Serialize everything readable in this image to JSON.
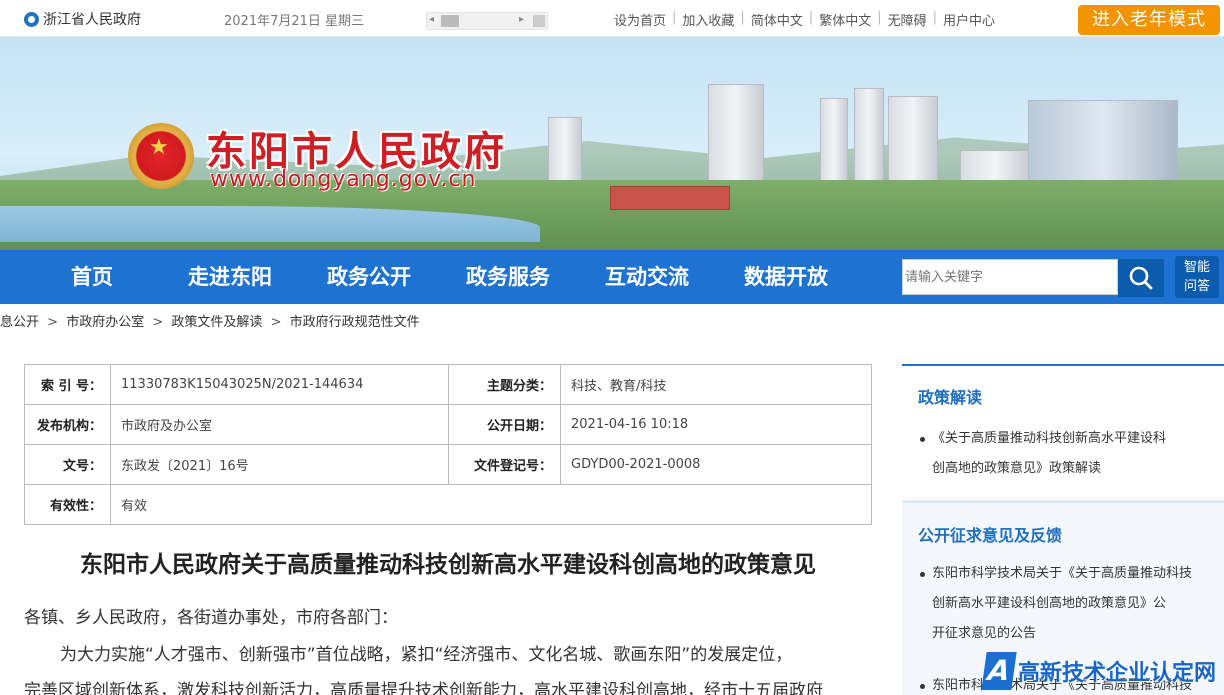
{
  "topbar": {
    "province": "浙江省人民政府",
    "date": "2021年7月21日 星期三",
    "links": [
      "设为首页",
      "加入收藏",
      "简体中文",
      "繁体中文",
      "无障碍",
      "用户中心"
    ],
    "elder_mode": "进入老年模式"
  },
  "banner": {
    "title": "东阳市人民政府",
    "url": "www.dongyang.gov.cn"
  },
  "nav": {
    "items": [
      "首页",
      "走进东阳",
      "政务公开",
      "政务服务",
      "互动交流",
      "数据开放"
    ],
    "search_placeholder": "请输入关键字",
    "smart_line1": "智能",
    "smart_line2": "问答"
  },
  "breadcrumb": [
    "息公开",
    "市政府办公室",
    "政策文件及解读",
    "市政府行政规范性文件"
  ],
  "info": {
    "index_label": "索 引 号：",
    "index_value": "11330783K15043025N/2021-144634",
    "topic_label": "主题分类：",
    "topic_value": "科技、教育/科技",
    "org_label": "发布机构：",
    "org_value": "市政府及办公室",
    "pubdate_label": "公开日期：",
    "pubdate_value": "2021-04-16 10:18",
    "docno_label": "文号：",
    "docno_value": "东政发〔2021〕16号",
    "regno_label": "文件登记号：",
    "regno_value": "GDYD00-2021-0008",
    "valid_label": "有效性：",
    "valid_value": "有效"
  },
  "document": {
    "title": "东阳市人民政府关于高质量推动科技创新高水平建设科创高地的政策意见",
    "salutation": "各镇、乡人民政府，各街道办事处，市府各部门：",
    "para1": "为大力实施“人才强市、创新强市”首位战略，紧扣“经济强市、文化名城、歌画东阳”的发展定位，",
    "para2": "完善区域创新体系，激发科技创新活力，高质量提升技术创新能力，高水平建设科创高地，经市十五届政府"
  },
  "sidebar": {
    "policy_head": "政策解读",
    "policy_item_l1": "《关于高质量推动科技创新高水平建设科",
    "policy_item_l2": "创高地的政策意见》政策解读",
    "consult_head": "公开征求意见及反馈",
    "consult_item_l1": "东阳市科学技术局关于《关于高质量推动科技",
    "consult_item_l2": "创新高水平建设科创高地的政策意见》公",
    "consult_item_l3": "开征求意见的公告",
    "consult_item2": "东阳市科学技术局关于《关于高质量推动科技"
  },
  "watermark": {
    "logo_letter": "A",
    "text": "高新技术企业认定网"
  },
  "colors": {
    "nav_blue": "#1e73d2",
    "elder_orange": "#f39300",
    "title_red": "#d01f24"
  }
}
